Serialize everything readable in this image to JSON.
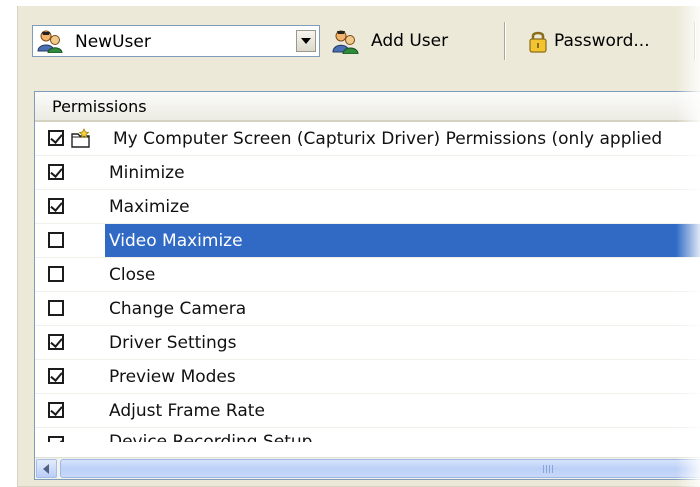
{
  "toolbar": {
    "user_select": {
      "value": "NewUser",
      "icon": "user-icon"
    },
    "add_user": {
      "label": "Add User",
      "icon": "users-icon"
    },
    "password": {
      "label": "Password...",
      "icon": "lock-icon"
    }
  },
  "list": {
    "header": "Permissions",
    "parent": {
      "label": "My Computer Screen (Capturix Driver) Permissions (only applied",
      "checked": true,
      "icon": "folder-icon"
    },
    "items": [
      {
        "label": "Minimize",
        "checked": true,
        "selected": false
      },
      {
        "label": "Maximize",
        "checked": true,
        "selected": false
      },
      {
        "label": "Video Maximize",
        "checked": false,
        "selected": true
      },
      {
        "label": "Close",
        "checked": false,
        "selected": false
      },
      {
        "label": "Change Camera",
        "checked": false,
        "selected": false
      },
      {
        "label": "Driver Settings",
        "checked": true,
        "selected": false
      },
      {
        "label": "Preview Modes",
        "checked": true,
        "selected": false
      },
      {
        "label": "Adjust Frame Rate",
        "checked": true,
        "selected": false
      },
      {
        "label": "Device Recording Setup",
        "checked": true,
        "selected": false
      }
    ]
  },
  "colors": {
    "selection": "#316ac5",
    "window_bg": "#ece9d8"
  }
}
